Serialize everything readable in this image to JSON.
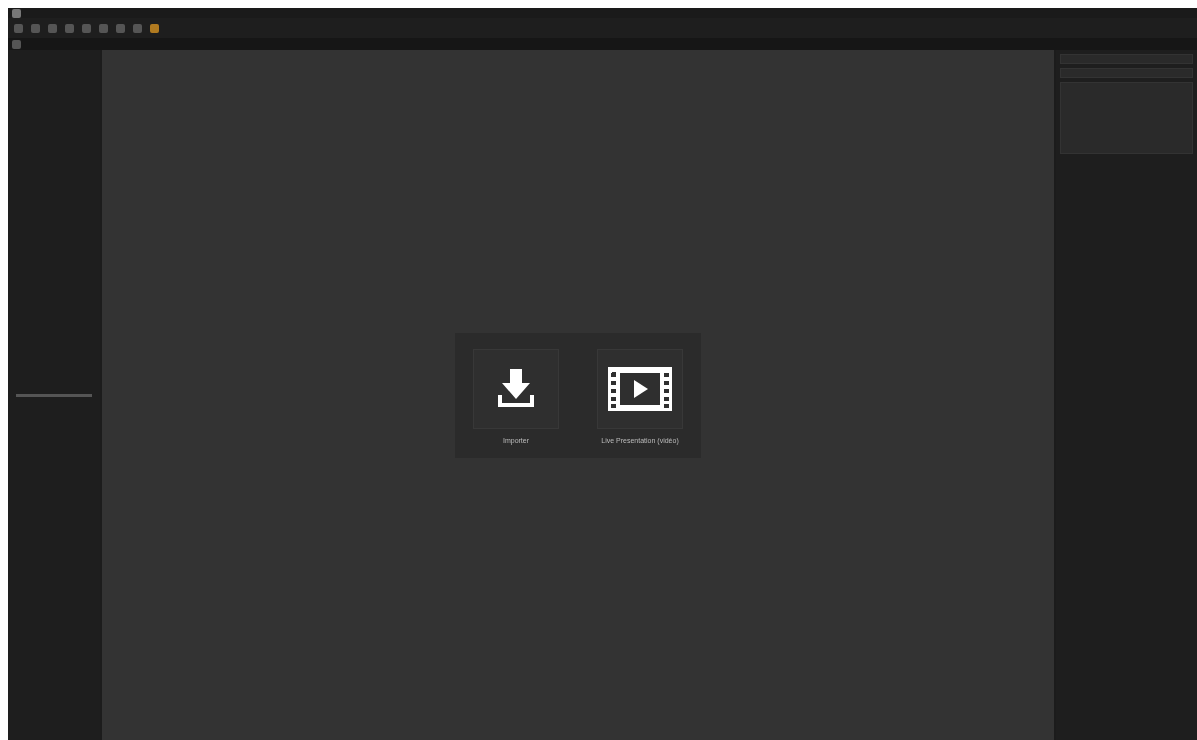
{
  "launcher": {
    "buttons": [
      {
        "kind": "import",
        "label": "Importer"
      },
      {
        "kind": "video",
        "label": "Live Presentation (vidéo)"
      }
    ]
  }
}
